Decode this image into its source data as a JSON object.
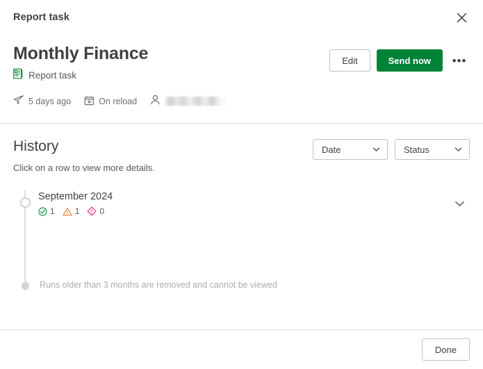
{
  "window": {
    "title": "Report task",
    "close_icon": "close-icon"
  },
  "header": {
    "name": "Monthly Finance",
    "type_label": "Report task",
    "type_icon": "report-icon",
    "accent_green": "#018236",
    "meta": [
      {
        "icon": "send-icon",
        "text": "5 days ago"
      },
      {
        "icon": "calendar-icon",
        "text": "On reload"
      },
      {
        "icon": "user-icon",
        "text": ""
      }
    ],
    "actions": {
      "edit_label": "Edit",
      "send_now_label": "Send now",
      "more_label": "•••"
    }
  },
  "history": {
    "title": "History",
    "hint": "Click on a row to view more details.",
    "filters": [
      {
        "label": "Date",
        "icon": "chevron-down-icon"
      },
      {
        "label": "Status",
        "icon": "chevron-down-icon"
      }
    ],
    "runs": [
      {
        "period": "September 2024",
        "expand_icon": "chevron-down-icon",
        "badges": [
          {
            "icon": "success-icon",
            "count": "1",
            "color": "#1a9a52"
          },
          {
            "icon": "warning-icon",
            "count": "1",
            "color": "#e8883a"
          },
          {
            "icon": "error-icon",
            "count": "0",
            "color": "#e5327f"
          }
        ]
      }
    ],
    "retention_note": "Runs older than 3 months are removed and cannot be viewed"
  },
  "footer": {
    "done_label": "Done"
  }
}
